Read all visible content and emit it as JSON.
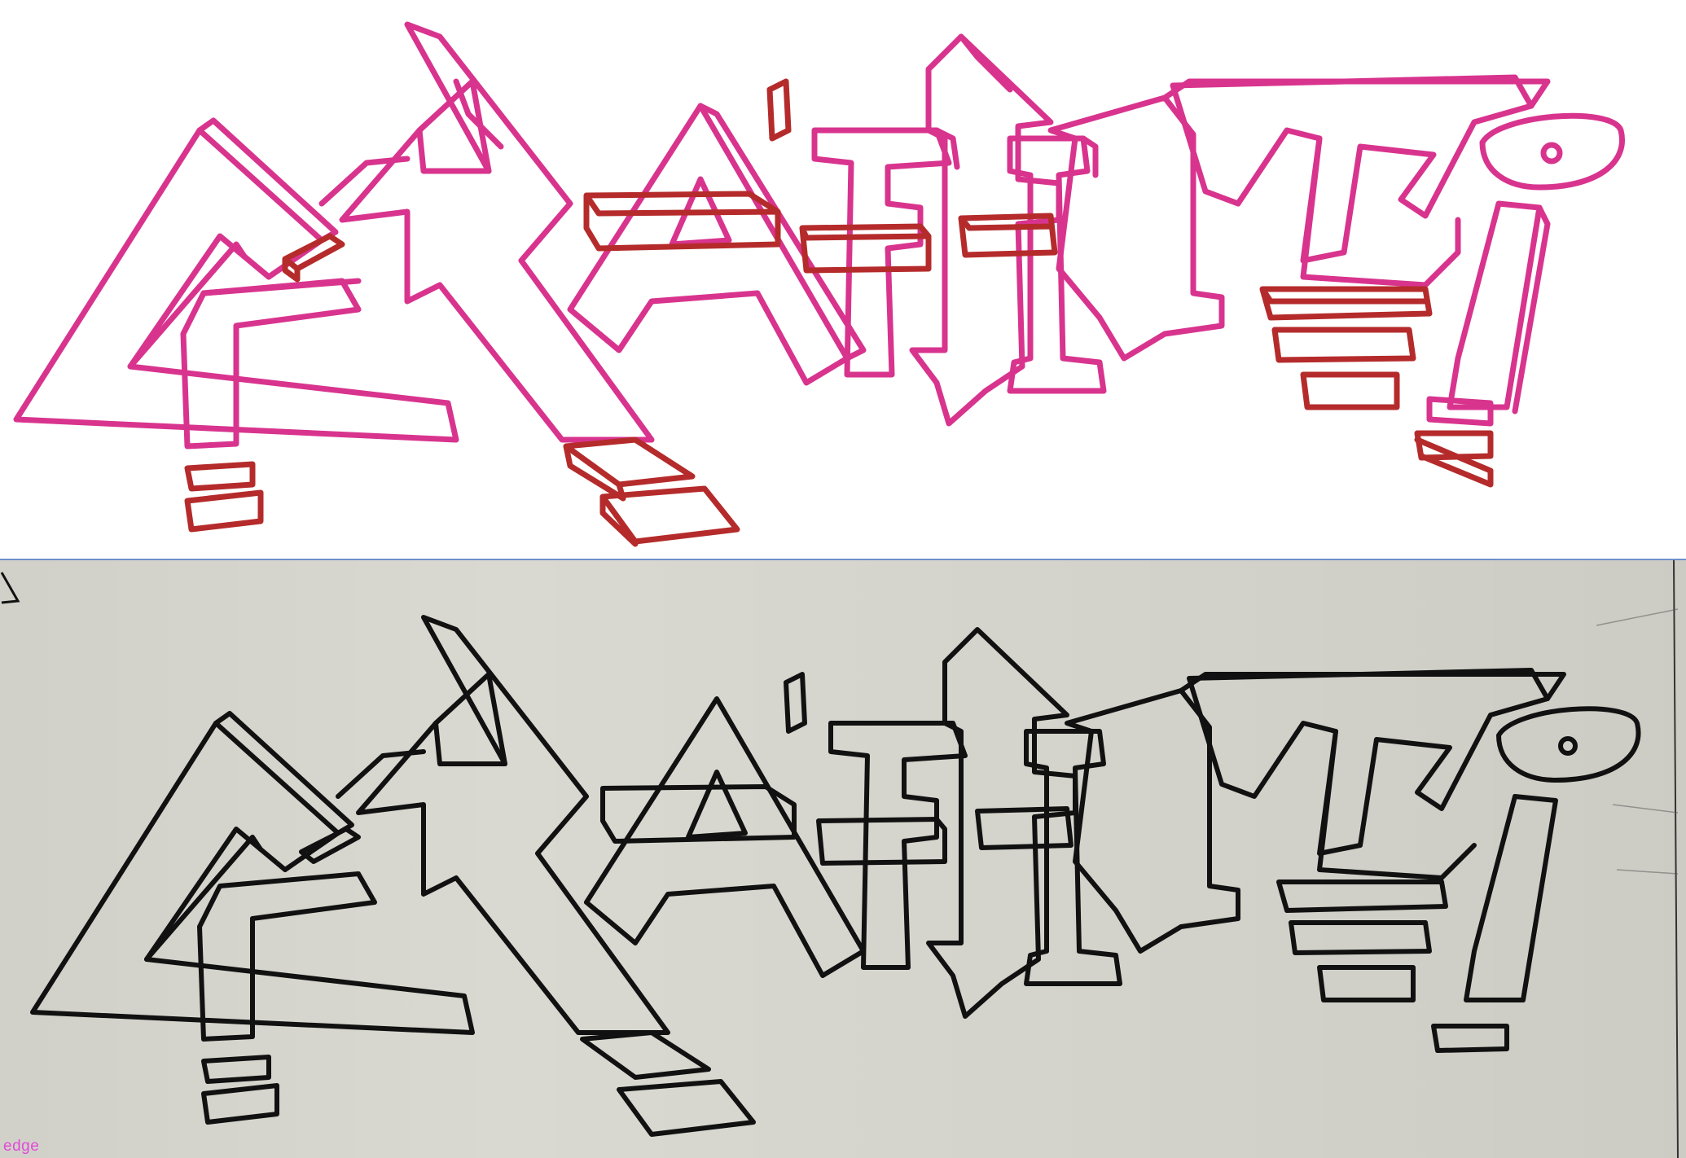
{
  "mode_label": "edge",
  "colors": {
    "outline_magenta": "#d8348e",
    "block_red": "#b52b2b",
    "pencil_black": "#111111",
    "paper": "#d9d9d1",
    "divider": "#6f8fc9",
    "label": "#e24ad8"
  },
  "icons": {
    "corner": "corner-bracket-icon"
  }
}
